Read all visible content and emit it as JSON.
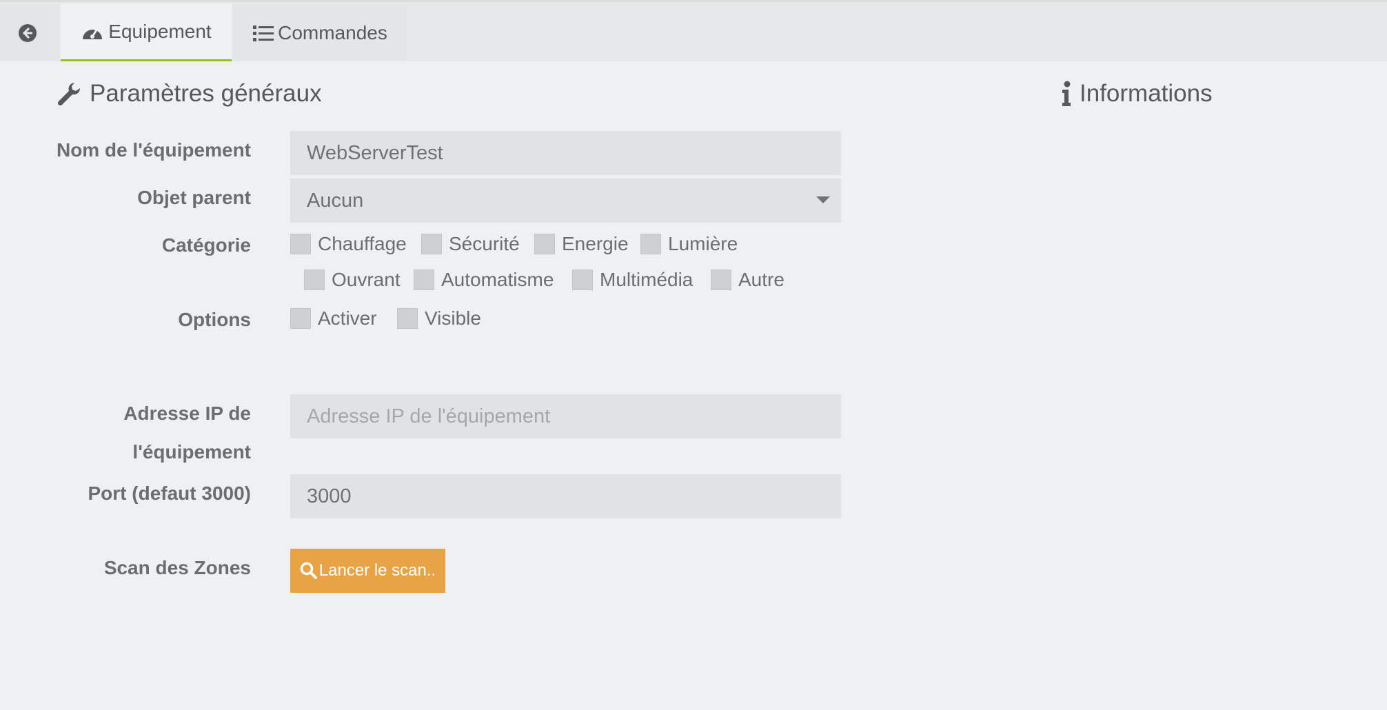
{
  "tabs": {
    "equipement": "Equipement",
    "commandes": "Commandes"
  },
  "sections": {
    "general": "Paramètres généraux",
    "info": "Informations"
  },
  "form": {
    "name_label": "Nom de l'équipement",
    "name_value": "WebServerTest",
    "parent_label": "Objet parent",
    "parent_value": "Aucun",
    "category_label": "Catégorie",
    "categories": [
      "Chauffage",
      "Sécurité",
      "Energie",
      "Lumière",
      "Ouvrant",
      "Automatisme",
      "Multimédia",
      "Autre"
    ],
    "options_label": "Options",
    "options": [
      "Activer",
      "Visible"
    ],
    "ip_label_line1": "Adresse IP de",
    "ip_label_line2": "l'équipement",
    "ip_placeholder": "Adresse IP de l'équipement",
    "port_label": "Port (defaut 3000)",
    "port_value": "3000",
    "scan_label": "Scan des Zones",
    "scan_button": "Lancer le scan.."
  },
  "colors": {
    "accent_tab": "#94c120",
    "scan_button": "#e8a444",
    "background": "#eff0f2"
  }
}
